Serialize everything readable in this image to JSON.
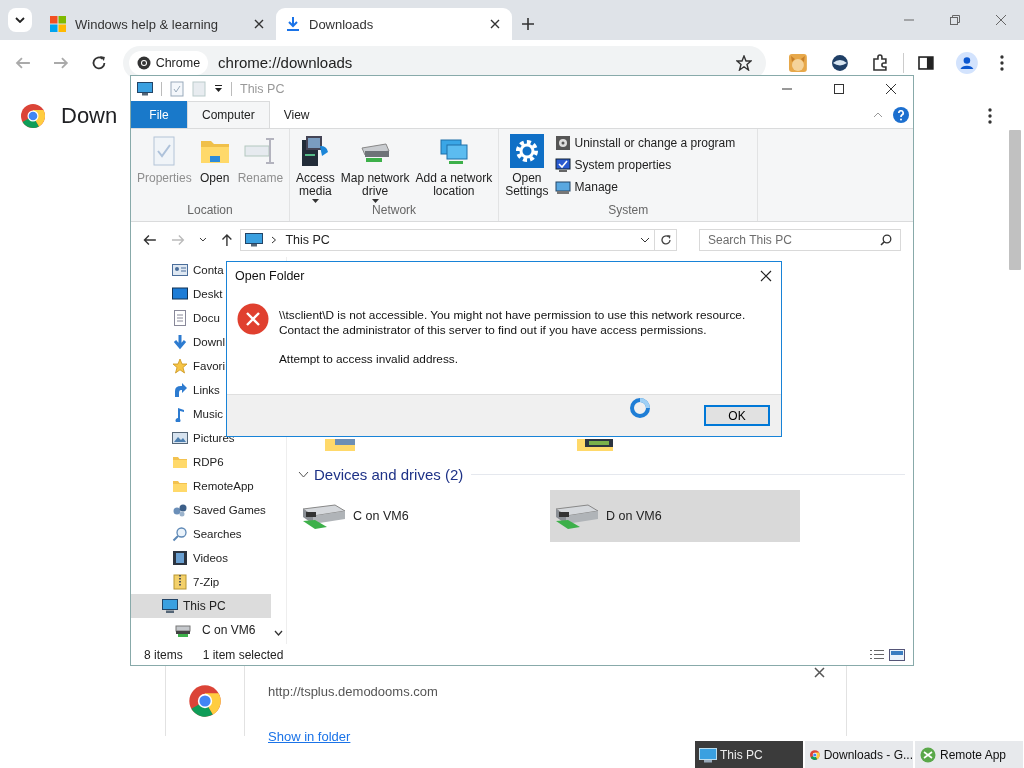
{
  "browser": {
    "tabs": [
      {
        "title": "Windows help & learning",
        "selected": false
      },
      {
        "title": "Downloads",
        "selected": true
      }
    ],
    "omnibox": {
      "chip": "Chrome",
      "url": "chrome://downloads"
    },
    "page_title": "Down",
    "download": {
      "source": "http://tsplus.demodooms.com",
      "action": "Show in folder"
    }
  },
  "explorer": {
    "title": "This PC",
    "ribbon_tabs": [
      {
        "label": "File",
        "kind": "file",
        "selected": false
      },
      {
        "label": "Computer",
        "kind": "tab",
        "selected": true
      },
      {
        "label": "View",
        "kind": "tab",
        "selected": false
      }
    ],
    "groups": [
      {
        "label": "Location",
        "buttons": [
          {
            "lines": [
              "Properties"
            ],
            "disabled": true,
            "dropdown": false
          },
          {
            "lines": [
              "Open"
            ],
            "disabled": false,
            "dropdown": false
          },
          {
            "lines": [
              "Rename"
            ],
            "disabled": true,
            "dropdown": false
          }
        ]
      },
      {
        "label": "Network",
        "buttons": [
          {
            "lines": [
              "Access",
              "media"
            ],
            "disabled": false,
            "dropdown": true
          },
          {
            "lines": [
              "Map network",
              "drive"
            ],
            "disabled": false,
            "dropdown": true
          },
          {
            "lines": [
              "Add a network",
              "location"
            ],
            "disabled": false,
            "dropdown": false
          }
        ]
      },
      {
        "label": "System",
        "buttons": [
          {
            "lines": [
              "Open",
              "Settings"
            ],
            "disabled": false,
            "dropdown": false
          }
        ],
        "small": [
          {
            "label": "Uninstall or change a program"
          },
          {
            "label": "System properties"
          },
          {
            "label": "Manage"
          }
        ]
      }
    ],
    "address": "This PC",
    "search_placeholder": "Search This PC",
    "nav": [
      {
        "label": "Conta",
        "selected": false
      },
      {
        "label": "Deskt",
        "selected": false
      },
      {
        "label": "Docu",
        "selected": false
      },
      {
        "label": "Downl",
        "selected": false
      },
      {
        "label": "Favori",
        "selected": false
      },
      {
        "label": "Links",
        "selected": false
      },
      {
        "label": "Music",
        "selected": false
      },
      {
        "label": "Pictures",
        "selected": false
      },
      {
        "label": "RDP6",
        "selected": false
      },
      {
        "label": "RemoteApp",
        "selected": false
      },
      {
        "label": "Saved Games",
        "selected": false
      },
      {
        "label": "Searches",
        "selected": false
      },
      {
        "label": "Videos",
        "selected": false
      },
      {
        "label": "7-Zip",
        "selected": false
      },
      {
        "label": "This PC",
        "selected": true,
        "children": [
          {
            "label": "C on VM6",
            "selected": false
          }
        ]
      }
    ],
    "section": {
      "title": "Devices and drives (2)",
      "expanded": true,
      "drives": [
        {
          "name": "C on VM6",
          "selected": false
        },
        {
          "name": "D on VM6",
          "selected": true
        }
      ]
    },
    "status": {
      "count": "8 items",
      "selection": "1 item selected"
    }
  },
  "dialog": {
    "title": "Open Folder",
    "message_lines": [
      "\\\\tsclient\\D is not accessible. You might not have permission to use this network resource.",
      "Contact the administrator of this server to find out if you have access permissions."
    ],
    "detail": "Attempt to access invalid address.",
    "button": "OK"
  },
  "taskbar": [
    {
      "label": "This PC",
      "selected": true
    },
    {
      "label": "Downloads - G...",
      "selected": false
    },
    {
      "label": "Remote App",
      "selected": false
    }
  ]
}
